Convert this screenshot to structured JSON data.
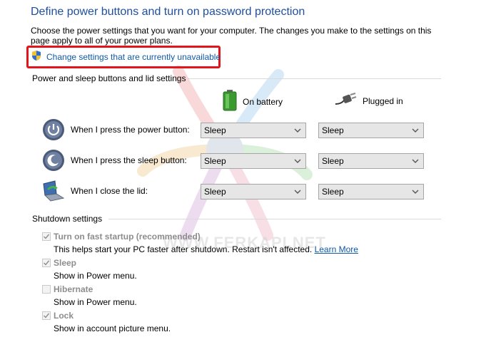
{
  "header": {
    "title": "Define power buttons and turn on password protection",
    "description": "Choose the power settings that you want for your computer. The changes you make to the settings on this page apply to all of your power plans.",
    "change_link": "Change settings that are currently unavailable"
  },
  "power_section": {
    "label": "Power and sleep buttons and lid settings",
    "columns": {
      "battery": "On battery",
      "plugged": "Plugged in"
    },
    "rows": [
      {
        "label": "When I press the power button:",
        "icon": "power-button-icon",
        "battery": "Sleep",
        "plugged": "Sleep"
      },
      {
        "label": "When I press the sleep button:",
        "icon": "sleep-button-icon",
        "battery": "Sleep",
        "plugged": "Sleep"
      },
      {
        "label": "When I close the lid:",
        "icon": "laptop-lid-icon",
        "battery": "Sleep",
        "plugged": "Sleep"
      }
    ]
  },
  "shutdown_section": {
    "label": "Shutdown settings",
    "items": [
      {
        "title": "Turn on fast startup (recommended)",
        "desc": "This helps start your PC faster after shutdown. Restart isn't affected.",
        "link": "Learn More",
        "checked": true
      },
      {
        "title": "Sleep",
        "desc": "Show in Power menu.",
        "checked": true
      },
      {
        "title": "Hibernate",
        "desc": "Show in Power menu.",
        "checked": false
      },
      {
        "title": "Lock",
        "desc": "Show in account picture menu.",
        "checked": true
      }
    ]
  },
  "watermark_text": "WWW.FERKAPI.NET",
  "colors": {
    "title": "#1e4fa0",
    "link": "#0f58a8",
    "highlight": "#e1151b",
    "disabled_text": "#8d8d8d"
  }
}
